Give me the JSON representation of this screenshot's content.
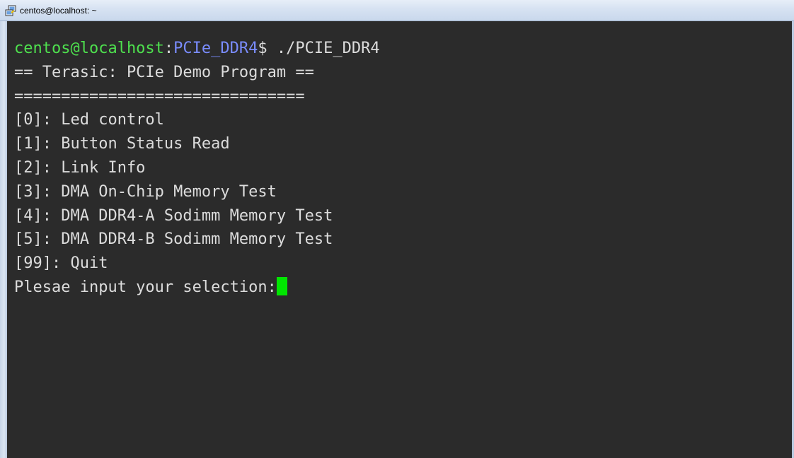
{
  "window": {
    "title": "centos@localhost: ~",
    "icon": "putty-icon"
  },
  "terminal": {
    "prompt_user": "centos@localhost",
    "prompt_colon": ":",
    "prompt_path": "PCIe_DDR4",
    "prompt_symbol": "$ ",
    "command": "./PCIE_DDR4",
    "lines": [
      "== Terasic: PCIe Demo Program ==",
      "===============================",
      "[0]: Led control",
      "[1]: Button Status Read",
      "[2]: Link Info",
      "[3]: DMA On-Chip Memory Test",
      "[4]: DMA DDR4-A Sodimm Memory Test",
      "[5]: DMA DDR4-B Sodimm Memory Test",
      "[99]: Quit"
    ],
    "input_prompt": "Plesae input your selection:"
  },
  "colors": {
    "background": "#2b2b2b",
    "text": "#dcdcdc",
    "user_host": "#4ee04e",
    "path": "#7a8cff",
    "cursor": "#00e600"
  }
}
